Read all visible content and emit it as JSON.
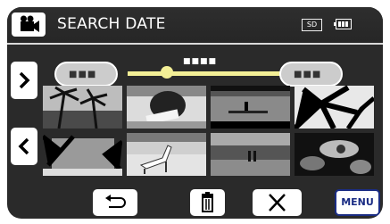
{
  "header": {
    "title": "SEARCH DATE",
    "media": "SD",
    "mode_icon": "video-camera-icon",
    "battery_icon": "battery-icon"
  },
  "date_selector": {
    "start_placeholder": "■■■",
    "selected_placeholder": "■■■■",
    "end_placeholder": "■■■"
  },
  "nav": {
    "next_icon": "chevron-right-icon",
    "prev_icon": "chevron-left-icon"
  },
  "thumbnails": [
    "palm-trees-beach",
    "person-reading",
    "lake-silhouette",
    "palm-leaves",
    "beach-with-palms",
    "beach-chairs",
    "couple-on-shore",
    "flower-leaves"
  ],
  "footer": {
    "back_icon": "return-arrow-icon",
    "delete_icon": "trash-icon",
    "close_icon": "close-icon",
    "menu_label": "MENU"
  },
  "colors": {
    "screen_bg": "#2a2a2a",
    "slider": "#f3ef96",
    "menu_accent": "#1a2c84"
  }
}
